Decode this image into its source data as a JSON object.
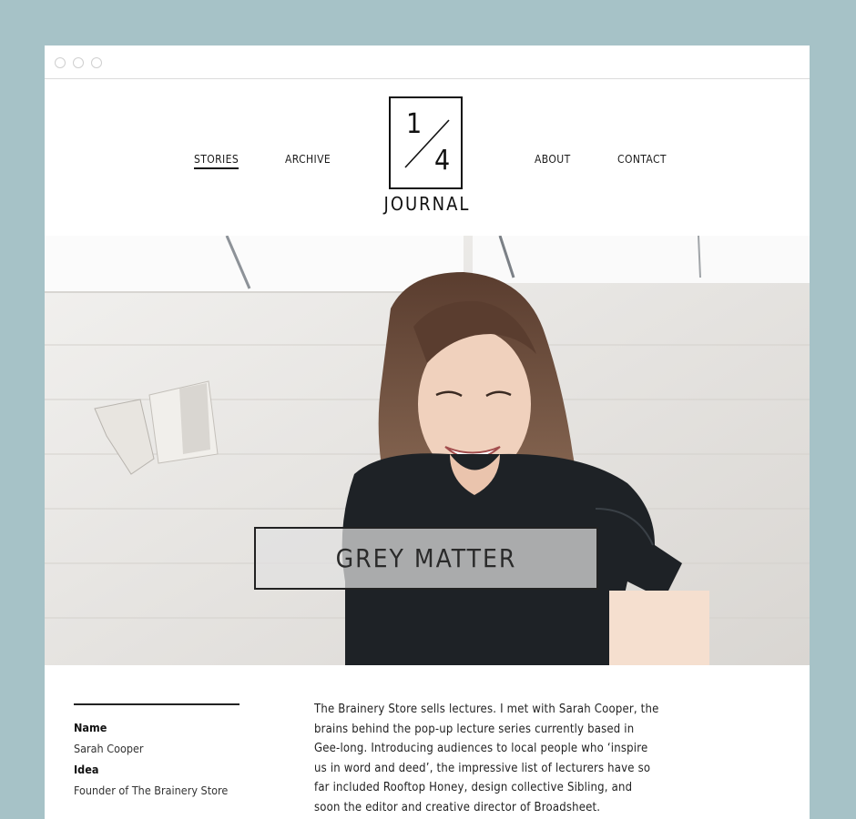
{
  "nav": {
    "stories": "STORIES",
    "archive": "ARCHIVE",
    "about": "ABOUT",
    "contact": "CONTACT"
  },
  "logo": {
    "numerator": "1",
    "denominator": "4",
    "wordmark": "JOURNAL"
  },
  "hero": {
    "title": "GREY MATTER"
  },
  "meta": {
    "name_label": "Name",
    "name_value": "Sarah Cooper",
    "idea_label": "Idea",
    "idea_value": "Founder of The Brainery Store"
  },
  "article": {
    "intro": "The Brainery Store sells lectures. I met with Sarah Cooper, the brains behind the pop-up lecture series currently based in Gee-long. Introducing audiences to local people who ‘inspire us in word and deed’, the impressive list of lecturers have so far included Rooftop Honey, design collective Sibling, and soon the editor and creative director of Broadsheet."
  },
  "colors": {
    "background": "#a6c2c7",
    "text": "#222222"
  }
}
